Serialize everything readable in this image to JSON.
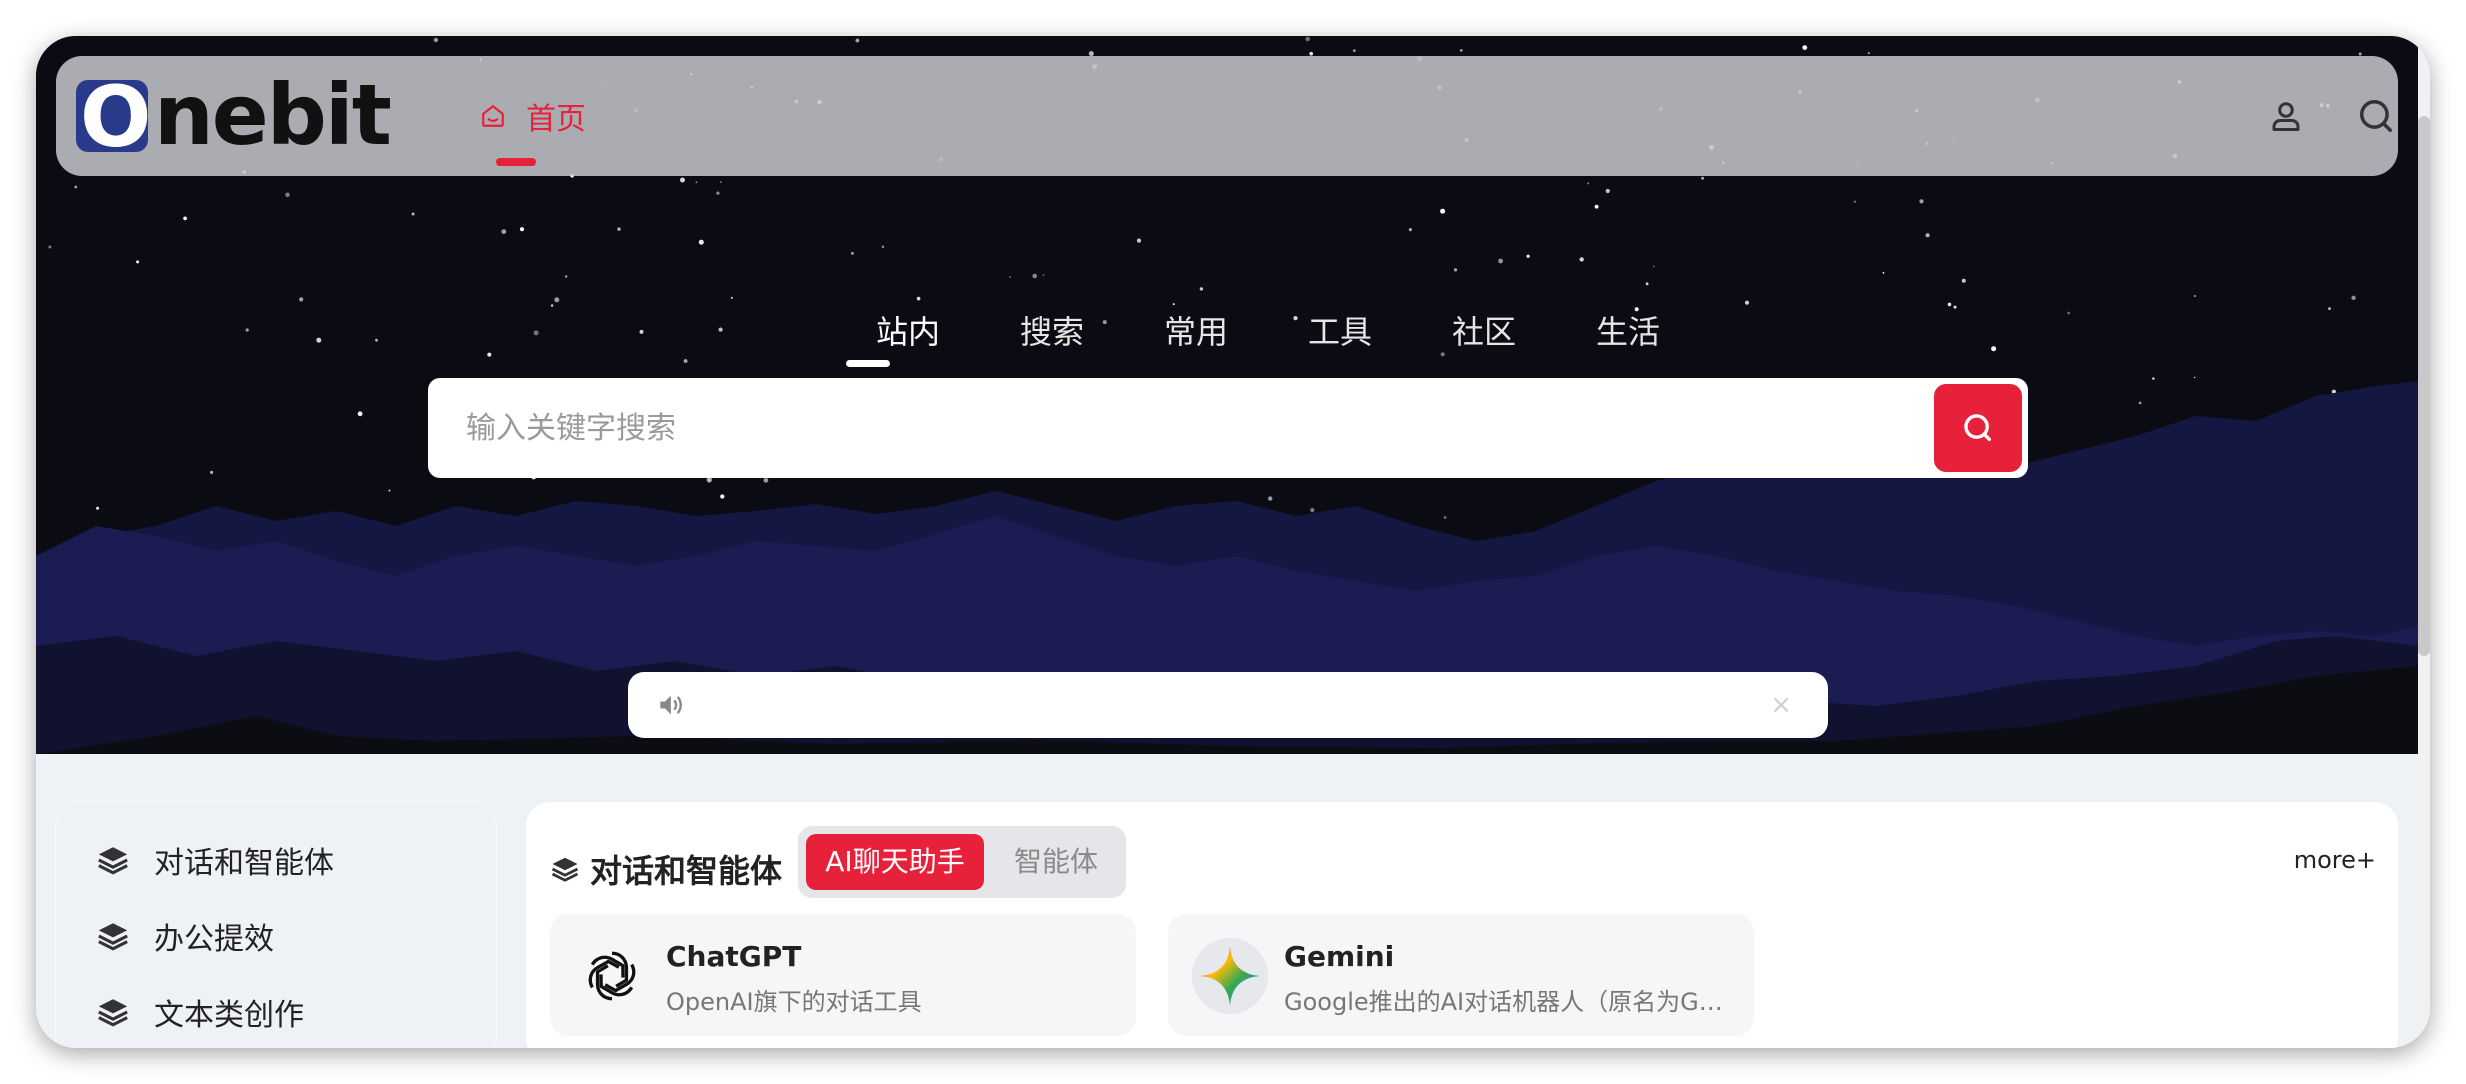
{
  "header": {
    "logo_first_letter": "O",
    "logo_rest": "nebit",
    "nav_home_label": "首页",
    "icons": [
      "user-icon",
      "search-icon"
    ]
  },
  "search": {
    "tabs": [
      "站内",
      "搜索",
      "常用",
      "工具",
      "社区",
      "生活"
    ],
    "active_tab": "站内",
    "placeholder": "输入关键字搜索"
  },
  "notice": {
    "text": "",
    "close": "×"
  },
  "sidebar": {
    "items": [
      {
        "label": "对话和智能体"
      },
      {
        "label": "办公提效"
      },
      {
        "label": "文本类创作"
      }
    ]
  },
  "main": {
    "section_title": "对话和智能体",
    "tabs": [
      "AI聊天助手",
      "智能体"
    ],
    "more": "more+",
    "cards": [
      {
        "name": "ChatGPT",
        "desc": "OpenAI旗下的对话工具"
      },
      {
        "name": "Gemini",
        "desc": "Google推出的AI对话机器人（原名为Go..."
      }
    ]
  },
  "colors": {
    "accent": "#e8213b",
    "hero_bg": "#0b0b14",
    "mountain": "#1a1c52"
  }
}
